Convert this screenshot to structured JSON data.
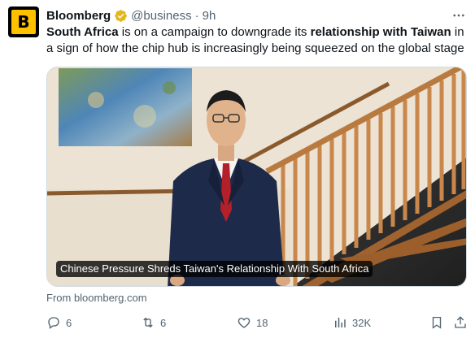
{
  "author": {
    "display_name": "Bloomberg",
    "handle": "@business",
    "separator": "·",
    "time": "9h",
    "avatar_letter": "B",
    "verified_color": "#e2b719"
  },
  "body": {
    "part1": "South Africa",
    "part2": " is on a campaign to downgrade its ",
    "part3": "relationship with Taiwan",
    "part4": " in a sign of how the chip hub is increasingly being squeezed on the global stage"
  },
  "media": {
    "caption": "Chinese Pressure Shreds Taiwan's Relationship With South Africa"
  },
  "source": "From bloomberg.com",
  "actions": {
    "replies": "6",
    "reposts": "6",
    "likes": "18",
    "views": "32K"
  },
  "colors": {
    "accent_gray": "#536471",
    "brand_yellow": "#ffc000"
  }
}
